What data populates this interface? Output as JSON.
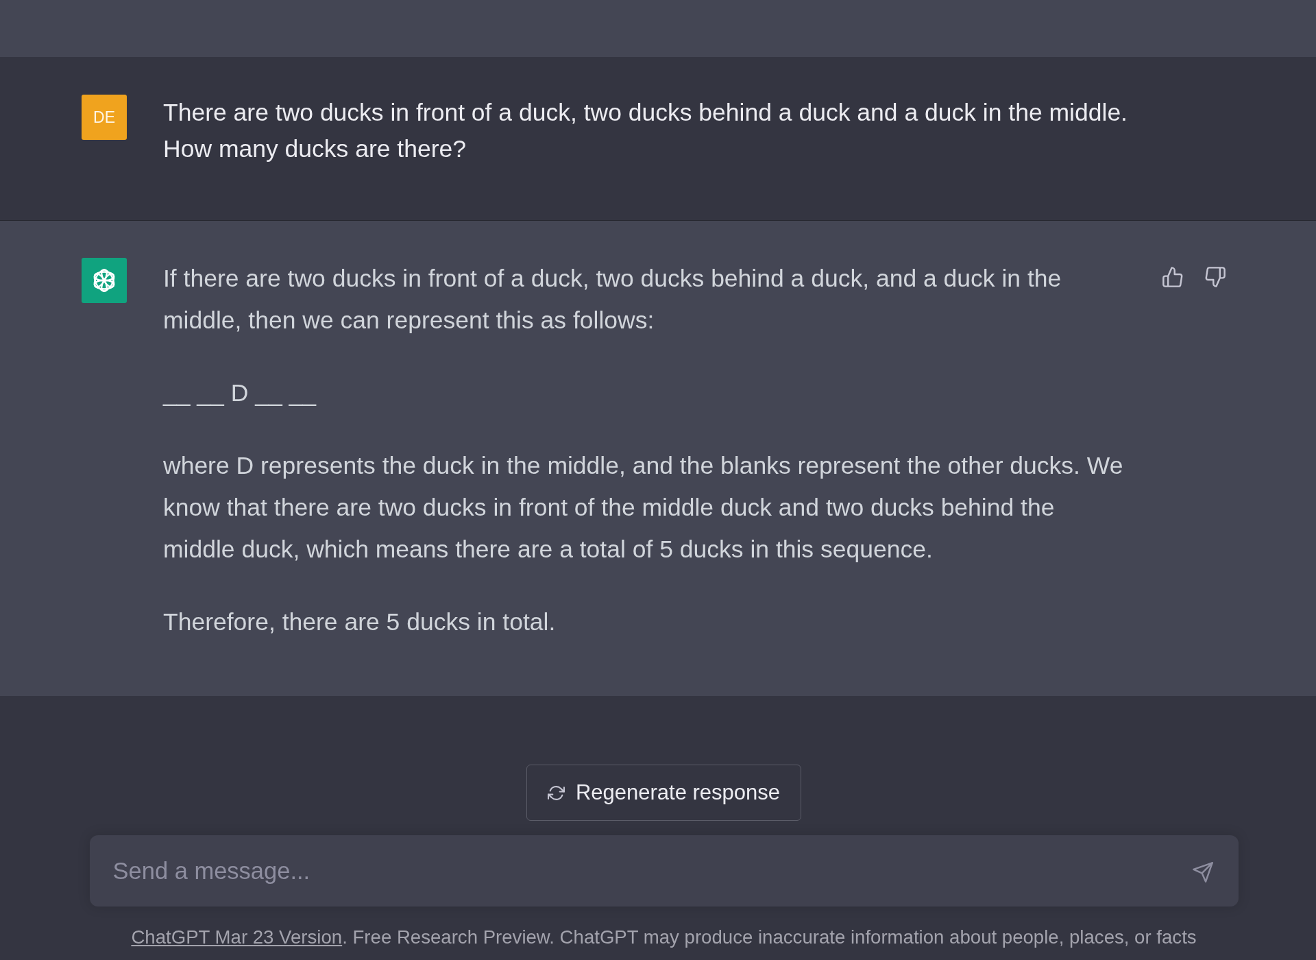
{
  "messages": [
    {
      "kind": "user",
      "avatar": "DE",
      "paragraphs": [
        "There are two ducks in front of a duck, two ducks behind a duck and a duck in the middle.\nHow many ducks are there?"
      ]
    },
    {
      "kind": "assistant",
      "paragraphs": [
        "If there are two ducks in front of a duck, two ducks behind a duck, and a duck in the middle, then we can represent this as follows:",
        "__ __ D __ __",
        "where D represents the duck in the middle, and the blanks represent the other ducks. We know that there are two ducks in front of the middle duck and two ducks behind the middle duck, which means there are a total of 5 ducks in this sequence.",
        "Therefore, there are 5 ducks in total."
      ]
    }
  ],
  "regenerate_button": {
    "label": "Regenerate response"
  },
  "composer": {
    "placeholder": "Send a message..."
  },
  "footer": {
    "link": "ChatGPT Mar 23 Version",
    "text": ". Free Research Preview. ChatGPT may produce inaccurate information about people, places, or facts"
  }
}
